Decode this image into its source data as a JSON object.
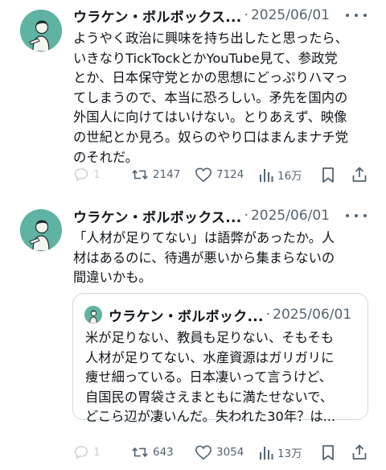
{
  "posts": [
    {
      "author": "ウラケン・ボルボックス...",
      "separator": "·",
      "date": "2025/06/01",
      "text": "ようやく政治に興味を持ち出したと思ったら、\nいきなりTickTockとかYouTube見て、参政党\nとか、日本保守党とかの思想にどっぷりハマっ\nてしまうので、本当に恐ろしい。矛先を国内の\n外国人に向けてはいけない。とりあえず、映像\nの世紀とか見ろ。奴らのやり口はまんまナチ党\nのそれだ。",
      "replies": "1",
      "reposts": "2147",
      "likes": "7124",
      "views": "16万"
    },
    {
      "author": "ウラケン・ボルボックス...",
      "separator": "·",
      "date": "2025/06/01",
      "text": "「人材が足りてない」は語弊があったか。人\n材はあるのに、待遇が悪いから集まらないの\n間違いかも。",
      "replies": "1",
      "reposts": "643",
      "likes": "3054",
      "views": "13万",
      "quote": {
        "author": "ウラケン・ボルボック...",
        "separator": "·",
        "date": "2025/06/01",
        "text": "米が足りない、教員も足りない、そもそも\n人材が足りてない、水産資源はガリガリに\n痩せ細っている。日本凄いって言うけど、\n自国民の胃袋さえまともに満たせないで、\nどこら辺が凄いんだ。失われた30年？は..."
      }
    }
  ],
  "icons": {
    "reply": "reply-icon",
    "repost": "repost-icon",
    "like": "heart-icon",
    "views": "views-icon",
    "bookmark": "bookmark-icon",
    "share": "share-icon",
    "more": "more-icon"
  },
  "colors": {
    "text": "#0f1419",
    "muted": "#536471",
    "border": "#cfd9de",
    "avatar_bg": "#5fb3a3"
  }
}
